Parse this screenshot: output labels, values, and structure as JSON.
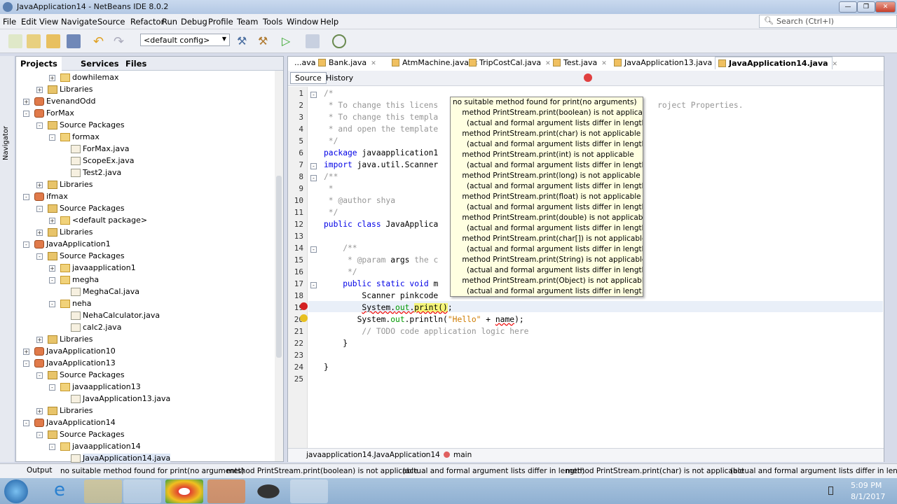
{
  "window": {
    "title": "JavaApplication14 - NetBeans IDE 8.0.2"
  },
  "menu": [
    "File",
    "Edit",
    "View",
    "Navigate",
    "Source",
    "Refactor",
    "Run",
    "Debug",
    "Profile",
    "Team",
    "Tools",
    "Window",
    "Help"
  ],
  "search": {
    "placeholder": "Search (Ctrl+I)"
  },
  "toolbar": {
    "config": "<default config>"
  },
  "panel_tabs": [
    "Projects",
    "Services",
    "Files"
  ],
  "navigator_label": "Navigator",
  "tree": [
    {
      "label": "dowhilemax",
      "level": 3,
      "type": "pkg",
      "exp": "+"
    },
    {
      "label": "Libraries",
      "level": 2,
      "type": "lib",
      "exp": "+"
    },
    {
      "label": "EvenandOdd",
      "level": 1,
      "type": "proj",
      "exp": "+"
    },
    {
      "label": "ForMax",
      "level": 1,
      "type": "proj",
      "exp": "-"
    },
    {
      "label": "Source Packages",
      "level": 2,
      "type": "lib",
      "exp": "-"
    },
    {
      "label": "formax",
      "level": 3,
      "type": "pkg",
      "exp": "-"
    },
    {
      "label": "ForMax.java",
      "level": 4,
      "type": "file"
    },
    {
      "label": "ScopeEx.java",
      "level": 4,
      "type": "file"
    },
    {
      "label": "Test2.java",
      "level": 4,
      "type": "file"
    },
    {
      "label": "Libraries",
      "level": 2,
      "type": "lib",
      "exp": "+"
    },
    {
      "label": "ifmax",
      "level": 1,
      "type": "proj",
      "exp": "-"
    },
    {
      "label": "Source Packages",
      "level": 2,
      "type": "lib",
      "exp": "-"
    },
    {
      "label": "<default package>",
      "level": 3,
      "type": "pkg",
      "exp": "+"
    },
    {
      "label": "Libraries",
      "level": 2,
      "type": "lib",
      "exp": "+"
    },
    {
      "label": "JavaApplication1",
      "level": 1,
      "type": "proj",
      "exp": "-"
    },
    {
      "label": "Source Packages",
      "level": 2,
      "type": "lib",
      "exp": "-"
    },
    {
      "label": "javaapplication1",
      "level": 3,
      "type": "pkg",
      "exp": "+"
    },
    {
      "label": "megha",
      "level": 3,
      "type": "pkg",
      "exp": "-"
    },
    {
      "label": "MeghaCal.java",
      "level": 4,
      "type": "file"
    },
    {
      "label": "neha",
      "level": 3,
      "type": "pkg",
      "exp": "-"
    },
    {
      "label": "NehaCalculator.java",
      "level": 4,
      "type": "file"
    },
    {
      "label": "calc2.java",
      "level": 4,
      "type": "file"
    },
    {
      "label": "Libraries",
      "level": 2,
      "type": "lib",
      "exp": "+"
    },
    {
      "label": "JavaApplication10",
      "level": 1,
      "type": "proj",
      "exp": "+"
    },
    {
      "label": "JavaApplication13",
      "level": 1,
      "type": "proj",
      "exp": "-"
    },
    {
      "label": "Source Packages",
      "level": 2,
      "type": "lib",
      "exp": "-"
    },
    {
      "label": "javaapplication13",
      "level": 3,
      "type": "pkg",
      "exp": "-"
    },
    {
      "label": "JavaApplication13.java",
      "level": 4,
      "type": "file"
    },
    {
      "label": "Libraries",
      "level": 2,
      "type": "lib",
      "exp": "+"
    },
    {
      "label": "JavaApplication14",
      "level": 1,
      "type": "proj",
      "exp": "-"
    },
    {
      "label": "Source Packages",
      "level": 2,
      "type": "lib",
      "exp": "-"
    },
    {
      "label": "javaapplication14",
      "level": 3,
      "type": "pkg",
      "exp": "-"
    },
    {
      "label": "JavaApplication14.java",
      "level": 4,
      "type": "file",
      "selected": true
    }
  ],
  "editor_tabs": [
    {
      "label": "...ava"
    },
    {
      "label": "Bank.java"
    },
    {
      "label": "AtmMachine.java"
    },
    {
      "label": "TripCostCal.java"
    },
    {
      "label": "Test.java"
    },
    {
      "label": "JavaApplication13.java"
    },
    {
      "label": "JavaApplication14.java",
      "active": true
    }
  ],
  "source_tabs": [
    "Source",
    "History"
  ],
  "code": [
    [
      {
        "t": "/*",
        "c": "cm"
      }
    ],
    [
      {
        "t": " * To change this licens",
        "c": "cm"
      },
      {
        "t": "                                              roject Properties.",
        "c": "cm"
      }
    ],
    [
      {
        "t": " * To change this templa",
        "c": "cm"
      }
    ],
    [
      {
        "t": " * and open the template",
        "c": "cm"
      }
    ],
    [
      {
        "t": " */",
        "c": "cm"
      }
    ],
    [
      {
        "t": "package",
        "c": "kw"
      },
      {
        "t": " javaapplication1"
      }
    ],
    [
      {
        "t": "import",
        "c": "kw"
      },
      {
        "t": " java.util.Scanner"
      }
    ],
    [
      {
        "t": "/**",
        "c": "cm"
      }
    ],
    [
      {
        "t": " *",
        "c": "cm"
      }
    ],
    [
      {
        "t": " * @author shya",
        "c": "cm"
      }
    ],
    [
      {
        "t": " */",
        "c": "cm"
      }
    ],
    [
      {
        "t": "public class",
        "c": "kw"
      },
      {
        "t": " JavaApplica"
      }
    ],
    [],
    [
      {
        "t": "    /**",
        "c": "cm"
      }
    ],
    [
      {
        "t": "     * @param ",
        "c": "cm"
      },
      {
        "t": "args"
      },
      {
        "t": " the c",
        "c": "cm"
      }
    ],
    [
      {
        "t": "     */",
        "c": "cm"
      }
    ],
    [
      {
        "t": "    public static void",
        "c": "kw"
      },
      {
        "t": " m"
      }
    ],
    [
      {
        "t": "        Scanner pinkcode"
      }
    ],
    [
      {
        "t": "        "
      },
      {
        "t": "System.",
        "c": "err"
      },
      {
        "t": "out",
        "c": "fld err"
      },
      {
        "t": ".",
        "c": "err"
      },
      {
        "t": "print()",
        "c": "err hl"
      },
      {
        "t": ";"
      }
    ],
    [
      {
        "t": "       System."
      },
      {
        "t": "out",
        "c": "fld"
      },
      {
        "t": ".println("
      },
      {
        "t": "\"Hello\"",
        "c": "st"
      },
      {
        "t": " + "
      },
      {
        "t": "name",
        "c": "err"
      },
      {
        "t": ");"
      }
    ],
    [
      {
        "t": "        // TODO code application logic here",
        "c": "cm"
      }
    ],
    [
      {
        "t": "    }"
      }
    ],
    [],
    [
      {
        "t": "}"
      }
    ],
    []
  ],
  "tooltip": [
    "no suitable method found for print(no arguments)",
    "    method PrintStream.print(boolean) is not applicable",
    "      (actual and formal argument lists differ in length)",
    "    method PrintStream.print(char) is not applicable",
    "      (actual and formal argument lists differ in length)",
    "    method PrintStream.print(int) is not applicable",
    "      (actual and formal argument lists differ in length)",
    "    method PrintStream.print(long) is not applicable",
    "      (actual and formal argument lists differ in length)",
    "    method PrintStream.print(float) is not applicable",
    "      (actual and formal argument lists differ in length)",
    "    method PrintStream.print(double) is not applicable",
    "      (actual and formal argument lists differ in length)",
    "    method PrintStream.print(char[]) is not applicable",
    "      (actual and formal argument lists differ in length)",
    "    method PrintStream.print(String) is not applicable",
    "      (actual and formal argument lists differ in length)",
    "    method PrintStream.print(Object) is not applicable",
    "      (actual and formal argument lists differ in lengt..."
  ],
  "breadcrumb": [
    "javaapplication14.JavaApplication14",
    "main"
  ],
  "status": {
    "output_label": "Output",
    "messages": [
      "no suitable method found for print(no arguments)",
      "method PrintStream.print(boolean) is not applicable",
      "(actual and formal argument lists differ in length)",
      "method PrintStream.print(char) is not applicable",
      "(actual and formal argument lists differ in length)"
    ]
  },
  "taskbar": {
    "time": "5:09 PM",
    "date": "8/1/2017"
  },
  "colors": {
    "keyword": "#0000e6",
    "comment": "#969696",
    "string": "#ce7b00",
    "tooltip_bg": "#ffffe1"
  }
}
